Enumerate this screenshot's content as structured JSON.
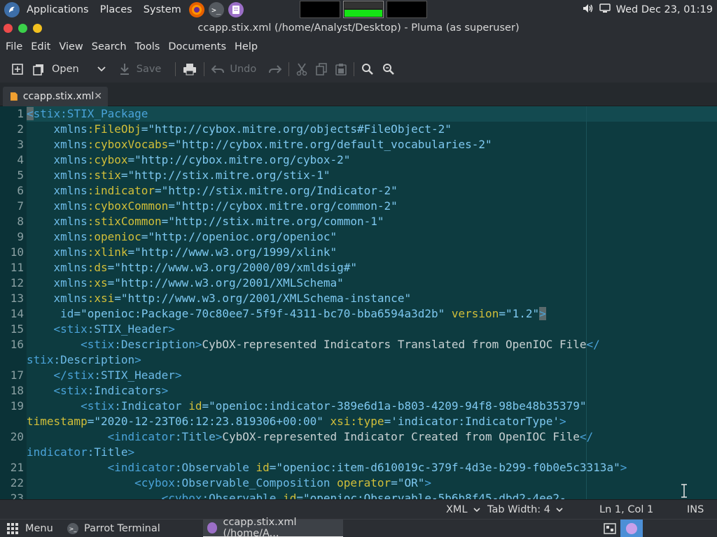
{
  "top_panel": {
    "menus": [
      "Applications",
      "Places",
      "System"
    ],
    "clock": "Wed Dec 23, 01:19"
  },
  "window": {
    "title": "ccapp.stix.xml (/home/Analyst/Desktop) - Pluma (as superuser)"
  },
  "menubar": {
    "file": "File",
    "edit": "Edit",
    "view": "View",
    "search": "Search",
    "tools": "Tools",
    "documents": "Documents",
    "help": "Help"
  },
  "toolbar": {
    "open_label": "Open",
    "save_label": "Save",
    "undo_label": "Undo"
  },
  "tab": {
    "label": "ccapp.stix.xml"
  },
  "editor": {
    "line_numbers": [
      "1",
      "2",
      "3",
      "4",
      "5",
      "6",
      "7",
      "8",
      "9",
      "10",
      "11",
      "12",
      "13",
      "14",
      "15",
      "16",
      "",
      "17",
      "18",
      "19",
      "",
      "20",
      "",
      "21",
      "22",
      "23"
    ]
  },
  "statusbar": {
    "language": "XML",
    "tab_width": "Tab Width: 4",
    "position": "Ln 1, Col 1",
    "mode": "INS"
  },
  "bottom_panel": {
    "menu_label": "Menu",
    "tasks": [
      "Parrot Terminal",
      "ccapp.stix.xml (/home/A..."
    ]
  },
  "colors": {
    "editor_bg": "#0d3b40",
    "tag": "#4aa3d9",
    "namespace": "#d2bf39",
    "value": "#7ec8f0"
  }
}
